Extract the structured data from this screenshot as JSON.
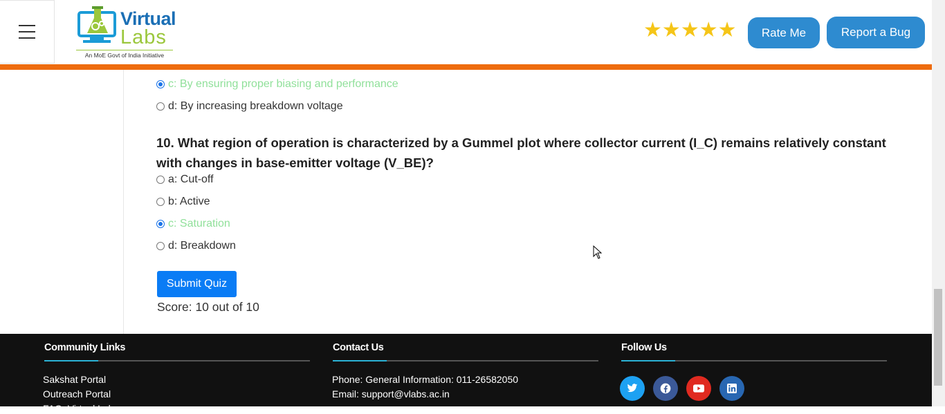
{
  "header": {
    "logo": {
      "word1": "Virtual",
      "word2": "Labs",
      "tagline": "An MoE Govt of India Initiative"
    },
    "rating_stars": 5,
    "rate_button": "Rate Me",
    "bug_button": "Report a Bug"
  },
  "quiz": {
    "prev_options": [
      {
        "label": "c: By ensuring proper biasing and performance",
        "checked": true,
        "correct": true
      },
      {
        "label": "d: By increasing breakdown voltage",
        "checked": false,
        "correct": false
      }
    ],
    "question": "10. What region of operation is characterized by a Gummel plot where collector current (I_C) remains relatively constant with changes in base-emitter voltage (V_BE)?",
    "options": [
      {
        "label": "a: Cut-off",
        "checked": false,
        "correct": false
      },
      {
        "label": "b: Active",
        "checked": false,
        "correct": false
      },
      {
        "label": "c: Saturation",
        "checked": true,
        "correct": true
      },
      {
        "label": "d: Breakdown",
        "checked": false,
        "correct": false
      }
    ],
    "submit_label": "Submit Quiz",
    "score": "Score: 10 out of 10"
  },
  "footer": {
    "community": {
      "heading": "Community Links",
      "links": [
        "Sakshat Portal",
        "Outreach Portal",
        "FAQ: Virtual Labs"
      ]
    },
    "contact": {
      "heading": "Contact Us",
      "phone": "Phone: General Information: 011-26582050",
      "email": "Email: support@vlabs.ac.in"
    },
    "follow": {
      "heading": "Follow Us",
      "icons": [
        "twitter-icon",
        "facebook-icon",
        "youtube-icon",
        "linkedin-icon"
      ]
    }
  },
  "colors": {
    "accent": "#2e8bd0",
    "orange": "#ee6c0f",
    "correct": "#90e09a",
    "submit": "#0a7cf5"
  }
}
